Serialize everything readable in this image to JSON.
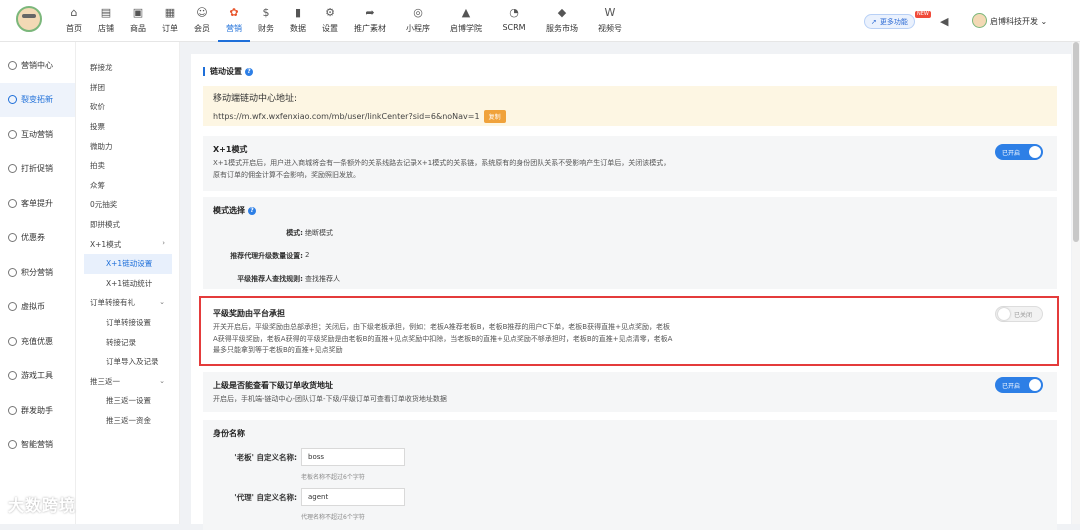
{
  "nav": [
    {
      "icon": "home-icon",
      "glyph": "⌂",
      "label": "首页"
    },
    {
      "icon": "store-icon",
      "glyph": "▤",
      "label": "店铺"
    },
    {
      "icon": "goods-icon",
      "glyph": "▣",
      "label": "商品"
    },
    {
      "icon": "order-icon",
      "glyph": "▦",
      "label": "订单"
    },
    {
      "icon": "member-icon",
      "glyph": "☺",
      "label": "会员"
    },
    {
      "icon": "marketing-icon",
      "glyph": "✿",
      "label": "营销"
    },
    {
      "icon": "finance-icon",
      "glyph": "$",
      "label": "财务"
    },
    {
      "icon": "data-icon",
      "glyph": "▮",
      "label": "数据"
    },
    {
      "icon": "settings-icon",
      "glyph": "⚙",
      "label": "设置"
    },
    {
      "icon": "share-icon",
      "glyph": "➦",
      "label": "推广素材"
    },
    {
      "icon": "miniapp-icon",
      "glyph": "◎",
      "label": "小程序"
    },
    {
      "icon": "academy-icon",
      "glyph": "▲",
      "label": "启博学院"
    },
    {
      "icon": "scrm-icon",
      "glyph": "◔",
      "label": "SCRM"
    },
    {
      "icon": "service-market-icon",
      "glyph": "◆",
      "label": "服务市场"
    },
    {
      "icon": "video-icon",
      "glyph": "W",
      "label": "视频号"
    }
  ],
  "header": {
    "more_label": "更多功能",
    "new_badge": "NEW",
    "user": "启博科技开发"
  },
  "sidebar": [
    "营销中心",
    "裂变拓新",
    "互动营销",
    "打折促销",
    "客单提升",
    "优惠券",
    "积分营销",
    "虚拟币",
    "充值优惠",
    "游戏工具",
    "群发助手",
    "智能营销"
  ],
  "submenu": [
    {
      "label": "群接龙",
      "level": 1
    },
    {
      "label": "拼团",
      "level": 1
    },
    {
      "label": "砍价",
      "level": 1
    },
    {
      "label": "投票",
      "level": 1
    },
    {
      "label": "微助力",
      "level": 1
    },
    {
      "label": "拍卖",
      "level": 1
    },
    {
      "label": "众筹",
      "level": 1
    },
    {
      "label": "0元抽奖",
      "level": 1
    },
    {
      "label": "即拼模式",
      "level": 1
    },
    {
      "label": "X+1模式",
      "level": 1,
      "chev": "›"
    },
    {
      "label": "X+1链动设置",
      "level": 2,
      "active": true
    },
    {
      "label": "X+1链动统计",
      "level": 2
    },
    {
      "label": "订单转接有礼",
      "level": 1,
      "chev": "⌄"
    },
    {
      "label": "订单转接设置",
      "level": 2
    },
    {
      "label": "转接记录",
      "level": 2
    },
    {
      "label": "订单导入及记录",
      "level": 2
    },
    {
      "label": "推三返一",
      "level": 1,
      "chev": "⌄"
    },
    {
      "label": "推三返一设置",
      "level": 2
    },
    {
      "label": "推三返一资金",
      "level": 2
    }
  ],
  "main": {
    "title": "链动设置",
    "link_label": "移动端链动中心地址:",
    "link_url": "https://m.wfx.wxfenxiao.com/mb/user/linkCenter?sid=6&noNav=1",
    "copy_label": "复制",
    "x1": {
      "title": "X+1模式",
      "desc": "X+1模式开启后，用户进入商城将会有一条额外的关系线路去记录X+1模式的关系链，系统原有的身份团队关系不受影响产生订单后，关闭该模式，原有订单的佣金计算不会影响，奖励照旧发放。",
      "toggle": "已开启"
    },
    "mode": {
      "title": "模式选择",
      "rows": [
        {
          "k": "模式:",
          "v": "绝断模式"
        },
        {
          "k": "推荐代理升级数量设置:",
          "v": "2"
        },
        {
          "k": "平级推荐人查找规则:",
          "v": "查找推荐人"
        }
      ]
    },
    "platform": {
      "title": "平级奖励由平台承担",
      "desc": "开关开启后，平级奖励由总部承担；关闭后，由下级老板承担，例如：老板A推荐老板B，老板B推荐的用户C下单，老板B获得直推+见点奖励，老板A获得平级奖励，老板A获得的平级奖励是由老板B的直推+见点奖励中扣除，当老板B的直推+见点奖励不够承担时，老板B的直推+见点清零，老板A最多只能拿到等于老板B的直推+见点奖励",
      "toggle": "已关闭"
    },
    "view_addr": {
      "title": "上级是否能查看下级订单收货地址",
      "desc": "开启后，手机端-链动中心-团队订单-下级/平级订单可查看订单收货地址数据",
      "toggle": "已开启"
    },
    "identity": {
      "title": "身份名称",
      "boss_label": "'老板'  自定义名称:",
      "boss_value": "boss",
      "boss_hint": "老板名称不超过6个字符",
      "agent_label": "'代理'  自定义名称:",
      "agent_value": "agent",
      "agent_hint": "代理名称不超过6个字符"
    }
  },
  "watermark": "大数跨境"
}
